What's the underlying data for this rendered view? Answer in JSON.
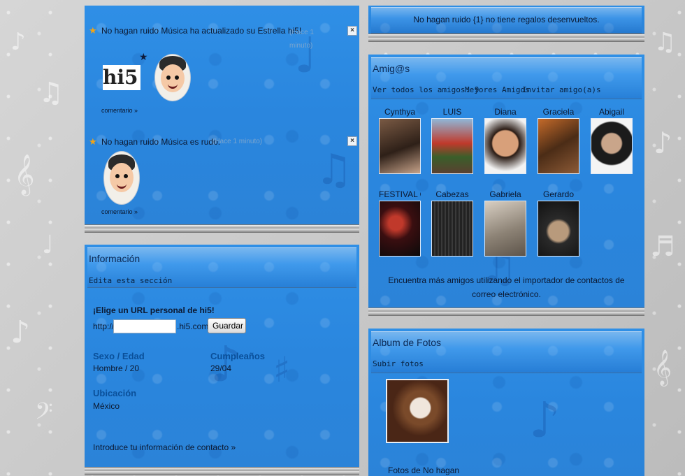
{
  "colors": {
    "panel_blue": "#2b86de",
    "frame_gray": "#cfcfcf",
    "link_dark": "#0c2a55"
  },
  "feed": {
    "item1": {
      "text": "No hagan ruido Música ha actualizado su Estrella hi5!",
      "time": "(Hace 1 minuto)",
      "comment": "comentario »",
      "logo": "hi5"
    },
    "item2": {
      "text": "No hagan ruido Música es rudo.",
      "time": "(Hace 1 minuto)",
      "comment": "comentario »"
    }
  },
  "gifts": {
    "text": "No hagan ruido {1} no tiene regalos desenvueltos."
  },
  "info": {
    "title": "Información",
    "edit": "Edita esta sección",
    "url_heading": "¡Elige un URL personal de hi5!",
    "url_prefix": "http://",
    "url_value": "",
    "url_suffix": ".hi5.com",
    "save": "Guardar",
    "sex_age_label": "Sexo / Edad",
    "sex_age": "Hombre /  20",
    "birthday_label": "Cumpleaños",
    "birthday": "29/04",
    "location_label": "Ubicación",
    "location": "México",
    "contact": "Introduce tu información de contacto »"
  },
  "friends": {
    "title": "Amig@s",
    "see_all": "Ver todos los amigos: 9",
    "best": "Mejores Amigos",
    "invite": "Invitar amigo(a)s",
    "list": [
      "Cynthya",
      "LUIS",
      "Diana",
      "Graciela",
      "Abigail",
      "FESTIVAL C",
      "Cabezas",
      "Gabriela",
      "Gerardo"
    ],
    "importer": "Encuentra más amigos utilizando el importador de contactos de correo electrónico."
  },
  "album": {
    "title": "Album de Fotos",
    "upload": "Subir fotos",
    "caption": "Fotos de No hagan"
  }
}
